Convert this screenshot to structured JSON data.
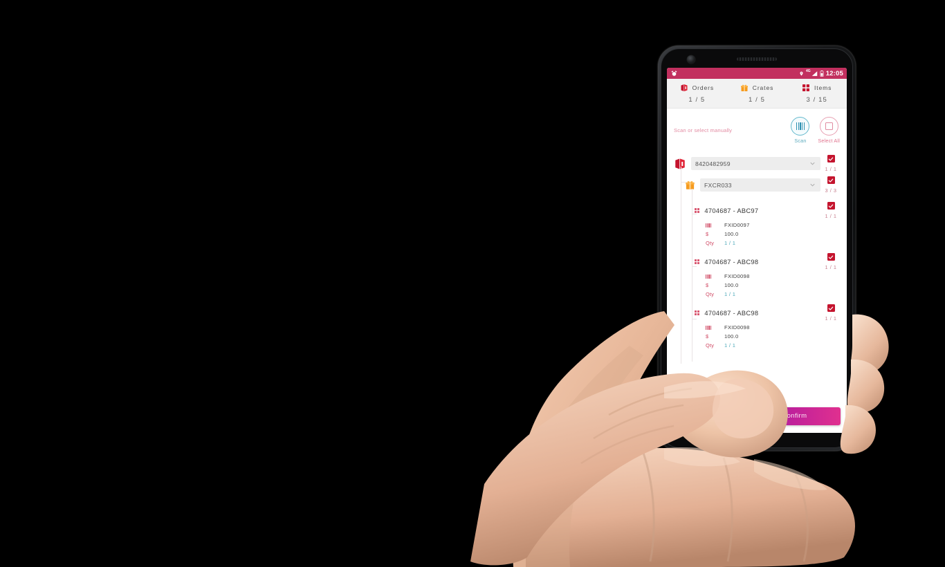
{
  "status_bar": {
    "app_icon": "alarm-icon",
    "location_icon": "location-pin-icon",
    "network_label": "4G",
    "signal_icon": "signal-bars-icon",
    "battery_icon": "battery-icon",
    "time": "12:05"
  },
  "summary_tabs": [
    {
      "icon": "package-box-icon",
      "label": "Orders",
      "count": "1 / 5"
    },
    {
      "icon": "crate-box-icon",
      "label": "Crates",
      "count": "1 / 5"
    },
    {
      "icon": "items-grid-icon",
      "label": "Items",
      "count": "3 / 15"
    }
  ],
  "scan_section": {
    "hint": "Scan or select manually",
    "scan_button": {
      "label": "Scan",
      "icon": "barcode-icon"
    },
    "select_all_button": {
      "label": "Select All",
      "icon": "square-outline-icon"
    }
  },
  "order": {
    "icon": "package-box-icon",
    "value": "8420482959",
    "checked": true,
    "count": "1 / 1"
  },
  "crate": {
    "icon": "crate-box-icon",
    "value": "FXCR033",
    "checked": true,
    "count": "3 / 3"
  },
  "items": [
    {
      "title": "4704687 - ABC97",
      "barcode_label": "",
      "barcode_value": "FXID0097",
      "price_label": "$",
      "price_value": "100.0",
      "qty_label": "Qty",
      "qty_value": "1 / 1",
      "checked": true,
      "count": "1 / 1"
    },
    {
      "title": "4704687 - ABC98",
      "barcode_label": "",
      "barcode_value": "FXID0098",
      "price_label": "$",
      "price_value": "100.0",
      "qty_label": "Qty",
      "qty_value": "1 / 1",
      "checked": true,
      "count": "1 / 1"
    },
    {
      "title": "4704687 - ABC98",
      "barcode_label": "",
      "barcode_value": "FXID0098",
      "price_label": "$",
      "price_value": "100.0",
      "qty_label": "Qty",
      "qty_value": "1 / 1",
      "checked": true,
      "count": "1 / 1"
    }
  ],
  "actions": {
    "secondary_label": "",
    "confirm_label": "Confirm"
  },
  "colors": {
    "header_pink": "#c2305f",
    "checkbox_red": "#c4142e",
    "scan_teal": "#2b8fb0",
    "select_pink": "#e08ba0",
    "confirm_gradient_start": "#8e2fb0",
    "confirm_gradient_end": "#e0308f",
    "qty_teal": "#4aa7b8"
  }
}
